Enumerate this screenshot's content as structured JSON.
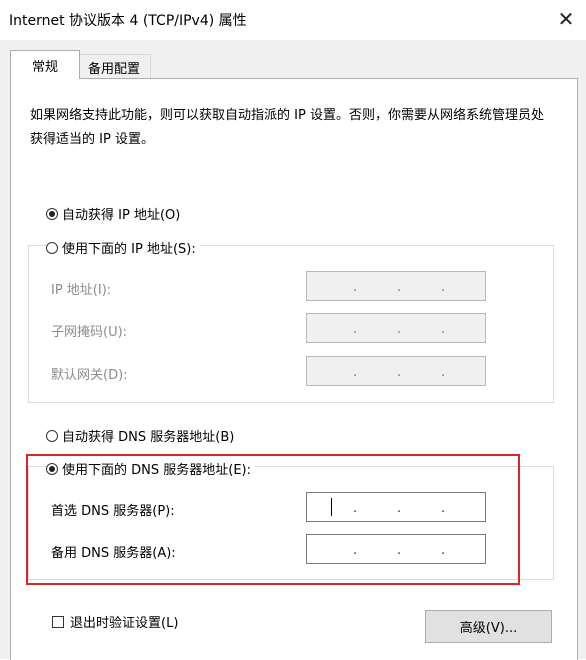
{
  "window": {
    "title": "Internet 协议版本 4 (TCP/IPv4) 属性",
    "close_glyph": "✕"
  },
  "tabs": [
    {
      "label": "常规",
      "active": true
    },
    {
      "label": "备用配置",
      "active": false
    }
  ],
  "description": "如果网络支持此功能，则可以获取自动指派的 IP 设置。否则，你需要从网络系统管理员处获得适当的 IP 设置。",
  "ip_section": {
    "auto_label": "自动获得 IP 地址(O)",
    "manual_label": "使用下面的 IP 地址(S):",
    "auto_selected": true,
    "fields": [
      {
        "label": "IP 地址(I):",
        "value": ". . ."
      },
      {
        "label": "子网掩码(U):",
        "value": ". . ."
      },
      {
        "label": "默认网关(D):",
        "value": ". . ."
      }
    ]
  },
  "dns_section": {
    "auto_label": "自动获得 DNS 服务器地址(B)",
    "manual_label": "使用下面的 DNS 服务器地址(E):",
    "manual_selected": true,
    "fields": [
      {
        "label": "首选 DNS 服务器(P):",
        "value": ". . ."
      },
      {
        "label": "备用 DNS 服务器(A):",
        "value": ". . ."
      }
    ]
  },
  "footer": {
    "validate_label": "退出时验证设置(L)",
    "validate_checked": false,
    "advanced_label": "高级(V)..."
  },
  "colors": {
    "highlight": "#d9262c",
    "panel_bg": "#ffffff",
    "dialog_bg": "#f0f0f0"
  }
}
